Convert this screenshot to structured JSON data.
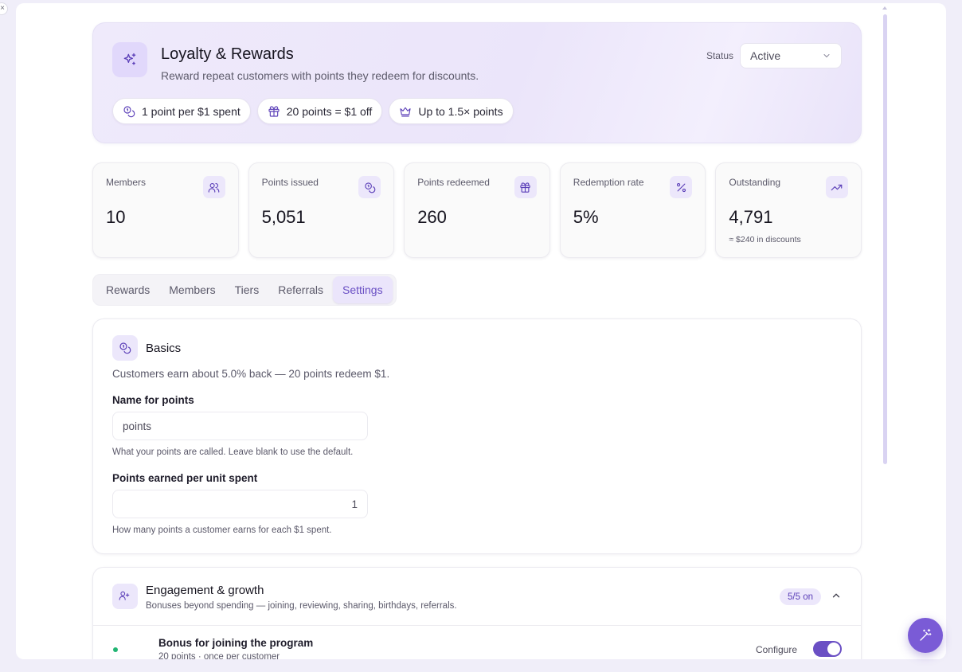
{
  "edge_close_glyph": "×",
  "header": {
    "title": "Loyalty & Rewards",
    "subtitle": "Reward repeat customers with points they redeem for discounts.",
    "status_label": "Status",
    "status_value": "Active",
    "chips": [
      {
        "icon": "coins-icon",
        "label": "1 point per $1 spent"
      },
      {
        "icon": "gift-icon",
        "label": "20 points = $1 off"
      },
      {
        "icon": "crown-icon",
        "label": "Up to 1.5× points"
      }
    ]
  },
  "stats": [
    {
      "label": "Members",
      "value": "10",
      "icon": "users-icon",
      "note": ""
    },
    {
      "label": "Points issued",
      "value": "5,051",
      "icon": "coins-icon",
      "note": ""
    },
    {
      "label": "Points redeemed",
      "value": "260",
      "icon": "gift-icon",
      "note": ""
    },
    {
      "label": "Redemption rate",
      "value": "5%",
      "icon": "percent-icon",
      "note": ""
    },
    {
      "label": "Outstanding",
      "value": "4,791",
      "icon": "trending-up-icon",
      "note": "≈ $240 in discounts"
    }
  ],
  "tabs": [
    {
      "label": "Rewards",
      "active": false
    },
    {
      "label": "Members",
      "active": false
    },
    {
      "label": "Tiers",
      "active": false
    },
    {
      "label": "Referrals",
      "active": false
    },
    {
      "label": "Settings",
      "active": true
    }
  ],
  "basics": {
    "title": "Basics",
    "description": "Customers earn about 5.0% back — 20 points redeem $1.",
    "name_label": "Name for points",
    "name_value": "points",
    "name_help": "What your points are called. Leave blank to use the default.",
    "rate_label": "Points earned per unit spent",
    "rate_value": "1",
    "rate_help": "How many points a customer earns for each $1 spent."
  },
  "engagement": {
    "title": "Engagement & growth",
    "subtitle": "Bonuses beyond spending — joining, reviewing, sharing, birthdays, referrals.",
    "badge": "5/5 on",
    "rows": [
      {
        "title": "Bonus for joining the program",
        "subtitle": "20 points · once per customer",
        "action": "Configure",
        "enabled": true
      }
    ]
  },
  "colors": {
    "accent": "#6a4fc4",
    "accent_soft": "#ece7fb",
    "status_green": "#22b573",
    "page_bg": "#f0eef9"
  }
}
